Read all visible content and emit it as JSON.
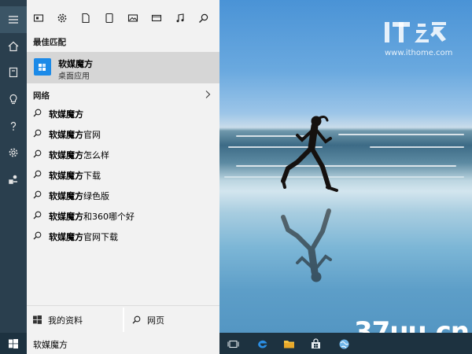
{
  "wallpaper": {
    "brand_logo_text": "IT之家",
    "brand_url": "www.ithome.com",
    "watermark": "37uu.cn"
  },
  "rail": {
    "items": [
      {
        "icon": "hamburger-menu-icon"
      },
      {
        "icon": "home-icon"
      },
      {
        "icon": "notebook-icon"
      },
      {
        "icon": "lightbulb-icon"
      },
      {
        "icon": "help-icon"
      },
      {
        "icon": "settings-gear-icon"
      },
      {
        "icon": "feedback-icon"
      }
    ]
  },
  "filters": [
    {
      "icon": "apps-filter-icon"
    },
    {
      "icon": "settings-filter-icon"
    },
    {
      "icon": "documents-filter-icon"
    },
    {
      "icon": "folders-filter-icon"
    },
    {
      "icon": "photos-filter-icon"
    },
    {
      "icon": "videos-filter-icon"
    },
    {
      "icon": "music-filter-icon"
    },
    {
      "icon": "web-filter-icon"
    }
  ],
  "best_match": {
    "section_label": "最佳匹配",
    "title": "软媒魔方",
    "subtitle": "桌面应用"
  },
  "web": {
    "section_label": "网络",
    "suggestions": [
      {
        "bold": "软媒魔方",
        "rest": ""
      },
      {
        "bold": "软媒魔方",
        "rest": "官网"
      },
      {
        "bold": "软媒魔方",
        "rest": "怎么样"
      },
      {
        "bold": "软媒魔方",
        "rest": "下载"
      },
      {
        "bold": "软媒魔方",
        "rest": "绿色版"
      },
      {
        "bold": "软媒魔方",
        "rest": "和360哪个好"
      },
      {
        "bold": "软媒魔方",
        "rest": "官网下载"
      }
    ]
  },
  "bottom": {
    "my_stuff": "我的资料",
    "web": "网页"
  },
  "taskbar": {
    "search_query": "软媒魔方",
    "items": [
      {
        "icon": "task-view-icon"
      },
      {
        "icon": "edge-browser-icon"
      },
      {
        "icon": "file-explorer-icon"
      },
      {
        "icon": "store-icon"
      },
      {
        "icon": "globe-icon"
      }
    ]
  },
  "colors": {
    "rail": "#2a3f4e",
    "panel": "#f2f2f2",
    "highlight": "#d6d6d6",
    "accent": "#1b8ae8",
    "taskbar": "#1d3240"
  }
}
